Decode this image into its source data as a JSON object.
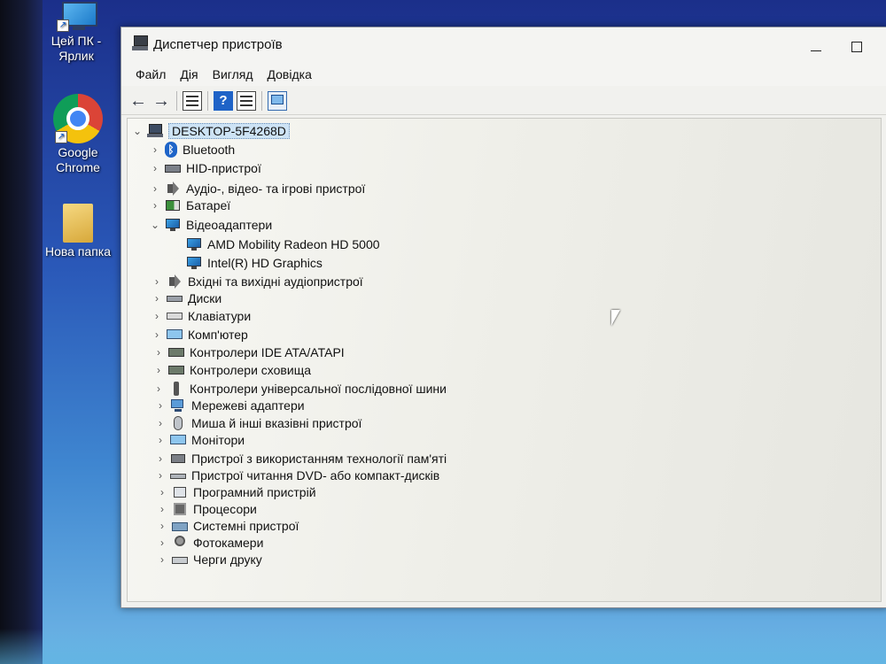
{
  "desktop": {
    "icons": [
      {
        "label_line1": "Цей ПК -",
        "label_line2": "Ярлик",
        "icon": "this-pc-icon"
      },
      {
        "label_line1": "Google",
        "label_line2": "Chrome",
        "icon": "chrome-icon"
      },
      {
        "label_line1": "Нова папка",
        "label_line2": "",
        "icon": "folder-icon"
      }
    ]
  },
  "window": {
    "title": "Диспетчер пристроїв",
    "menu": [
      "Файл",
      "Дія",
      "Вигляд",
      "Довідка"
    ],
    "toolbar": {
      "back_icon": "back-arrow-icon",
      "forward_icon": "forward-arrow-icon",
      "help_glyph": "?"
    },
    "tree": {
      "root": {
        "label": "DESKTOP-5F4268D",
        "expanded": true
      },
      "categories": [
        {
          "label": "Bluetooth",
          "icon": "bluetooth-icon",
          "expanded": false
        },
        {
          "label": "HID-пристрої",
          "icon": "hid-icon",
          "expanded": false
        },
        {
          "label": "Аудіо-, відео- та ігрові пристрої",
          "icon": "audio-icon",
          "expanded": false
        },
        {
          "label": "Батареї",
          "icon": "battery-icon",
          "expanded": false
        },
        {
          "label": "Відеоадаптери",
          "icon": "display-adapter-icon",
          "expanded": true,
          "children": [
            "AMD Mobility Radeon HD 5000",
            "Intel(R) HD Graphics"
          ]
        },
        {
          "label": "Вхідні та вихідні аудіопристрої",
          "icon": "audio-io-icon",
          "expanded": false
        },
        {
          "label": "Диски",
          "icon": "disk-icon",
          "expanded": false
        },
        {
          "label": "Клавіатури",
          "icon": "keyboard-icon",
          "expanded": false
        },
        {
          "label": "Комп'ютер",
          "icon": "computer-icon",
          "expanded": false
        },
        {
          "label": "Контролери IDE ATA/ATAPI",
          "icon": "ide-controller-icon",
          "expanded": false
        },
        {
          "label": "Контролери сховища",
          "icon": "storage-controller-icon",
          "expanded": false
        },
        {
          "label": "Контролери універсальної послідовної шини",
          "icon": "usb-icon",
          "expanded": false
        },
        {
          "label": "Мережеві адаптери",
          "icon": "network-icon",
          "expanded": false
        },
        {
          "label": "Миша й інші вказівні пристрої",
          "icon": "mouse-icon",
          "expanded": false
        },
        {
          "label": "Монітори",
          "icon": "monitor-icon",
          "expanded": false
        },
        {
          "label": "Пристрої з використанням технології пам'яті",
          "icon": "memory-icon",
          "expanded": false
        },
        {
          "label": "Пристрої читання DVD- або компакт-дисків",
          "icon": "dvd-icon",
          "expanded": false
        },
        {
          "label": "Програмний пристрій",
          "icon": "software-device-icon",
          "expanded": false
        },
        {
          "label": "Процесори",
          "icon": "cpu-icon",
          "expanded": false
        },
        {
          "label": "Системні пристрої",
          "icon": "system-device-icon",
          "expanded": false
        },
        {
          "label": "Фотокамери",
          "icon": "camera-icon",
          "expanded": false
        },
        {
          "label": "Черги друку",
          "icon": "printer-icon",
          "expanded": false
        }
      ]
    }
  },
  "colors": {
    "selection": "#cde3f5",
    "help_blue": "#1f63c7"
  }
}
